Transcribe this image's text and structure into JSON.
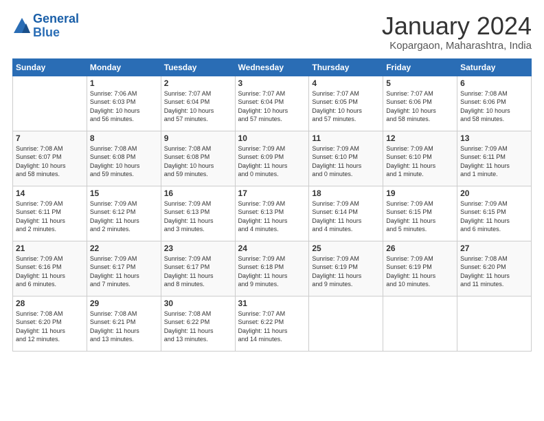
{
  "header": {
    "logo_line1": "General",
    "logo_line2": "Blue",
    "title": "January 2024",
    "location": "Kopargaon, Maharashtra, India"
  },
  "weekdays": [
    "Sunday",
    "Monday",
    "Tuesday",
    "Wednesday",
    "Thursday",
    "Friday",
    "Saturday"
  ],
  "weeks": [
    [
      {
        "num": "",
        "info": ""
      },
      {
        "num": "1",
        "info": "Sunrise: 7:06 AM\nSunset: 6:03 PM\nDaylight: 10 hours\nand 56 minutes."
      },
      {
        "num": "2",
        "info": "Sunrise: 7:07 AM\nSunset: 6:04 PM\nDaylight: 10 hours\nand 57 minutes."
      },
      {
        "num": "3",
        "info": "Sunrise: 7:07 AM\nSunset: 6:04 PM\nDaylight: 10 hours\nand 57 minutes."
      },
      {
        "num": "4",
        "info": "Sunrise: 7:07 AM\nSunset: 6:05 PM\nDaylight: 10 hours\nand 57 minutes."
      },
      {
        "num": "5",
        "info": "Sunrise: 7:07 AM\nSunset: 6:06 PM\nDaylight: 10 hours\nand 58 minutes."
      },
      {
        "num": "6",
        "info": "Sunrise: 7:08 AM\nSunset: 6:06 PM\nDaylight: 10 hours\nand 58 minutes."
      }
    ],
    [
      {
        "num": "7",
        "info": "Sunrise: 7:08 AM\nSunset: 6:07 PM\nDaylight: 10 hours\nand 58 minutes."
      },
      {
        "num": "8",
        "info": "Sunrise: 7:08 AM\nSunset: 6:08 PM\nDaylight: 10 hours\nand 59 minutes."
      },
      {
        "num": "9",
        "info": "Sunrise: 7:08 AM\nSunset: 6:08 PM\nDaylight: 10 hours\nand 59 minutes."
      },
      {
        "num": "10",
        "info": "Sunrise: 7:09 AM\nSunset: 6:09 PM\nDaylight: 11 hours\nand 0 minutes."
      },
      {
        "num": "11",
        "info": "Sunrise: 7:09 AM\nSunset: 6:10 PM\nDaylight: 11 hours\nand 0 minutes."
      },
      {
        "num": "12",
        "info": "Sunrise: 7:09 AM\nSunset: 6:10 PM\nDaylight: 11 hours\nand 1 minute."
      },
      {
        "num": "13",
        "info": "Sunrise: 7:09 AM\nSunset: 6:11 PM\nDaylight: 11 hours\nand 1 minute."
      }
    ],
    [
      {
        "num": "14",
        "info": "Sunrise: 7:09 AM\nSunset: 6:11 PM\nDaylight: 11 hours\nand 2 minutes."
      },
      {
        "num": "15",
        "info": "Sunrise: 7:09 AM\nSunset: 6:12 PM\nDaylight: 11 hours\nand 2 minutes."
      },
      {
        "num": "16",
        "info": "Sunrise: 7:09 AM\nSunset: 6:13 PM\nDaylight: 11 hours\nand 3 minutes."
      },
      {
        "num": "17",
        "info": "Sunrise: 7:09 AM\nSunset: 6:13 PM\nDaylight: 11 hours\nand 4 minutes."
      },
      {
        "num": "18",
        "info": "Sunrise: 7:09 AM\nSunset: 6:14 PM\nDaylight: 11 hours\nand 4 minutes."
      },
      {
        "num": "19",
        "info": "Sunrise: 7:09 AM\nSunset: 6:15 PM\nDaylight: 11 hours\nand 5 minutes."
      },
      {
        "num": "20",
        "info": "Sunrise: 7:09 AM\nSunset: 6:15 PM\nDaylight: 11 hours\nand 6 minutes."
      }
    ],
    [
      {
        "num": "21",
        "info": "Sunrise: 7:09 AM\nSunset: 6:16 PM\nDaylight: 11 hours\nand 6 minutes."
      },
      {
        "num": "22",
        "info": "Sunrise: 7:09 AM\nSunset: 6:17 PM\nDaylight: 11 hours\nand 7 minutes."
      },
      {
        "num": "23",
        "info": "Sunrise: 7:09 AM\nSunset: 6:17 PM\nDaylight: 11 hours\nand 8 minutes."
      },
      {
        "num": "24",
        "info": "Sunrise: 7:09 AM\nSunset: 6:18 PM\nDaylight: 11 hours\nand 9 minutes."
      },
      {
        "num": "25",
        "info": "Sunrise: 7:09 AM\nSunset: 6:19 PM\nDaylight: 11 hours\nand 9 minutes."
      },
      {
        "num": "26",
        "info": "Sunrise: 7:09 AM\nSunset: 6:19 PM\nDaylight: 11 hours\nand 10 minutes."
      },
      {
        "num": "27",
        "info": "Sunrise: 7:08 AM\nSunset: 6:20 PM\nDaylight: 11 hours\nand 11 minutes."
      }
    ],
    [
      {
        "num": "28",
        "info": "Sunrise: 7:08 AM\nSunset: 6:20 PM\nDaylight: 11 hours\nand 12 minutes."
      },
      {
        "num": "29",
        "info": "Sunrise: 7:08 AM\nSunset: 6:21 PM\nDaylight: 11 hours\nand 13 minutes."
      },
      {
        "num": "30",
        "info": "Sunrise: 7:08 AM\nSunset: 6:22 PM\nDaylight: 11 hours\nand 13 minutes."
      },
      {
        "num": "31",
        "info": "Sunrise: 7:07 AM\nSunset: 6:22 PM\nDaylight: 11 hours\nand 14 minutes."
      },
      {
        "num": "",
        "info": ""
      },
      {
        "num": "",
        "info": ""
      },
      {
        "num": "",
        "info": ""
      }
    ]
  ]
}
